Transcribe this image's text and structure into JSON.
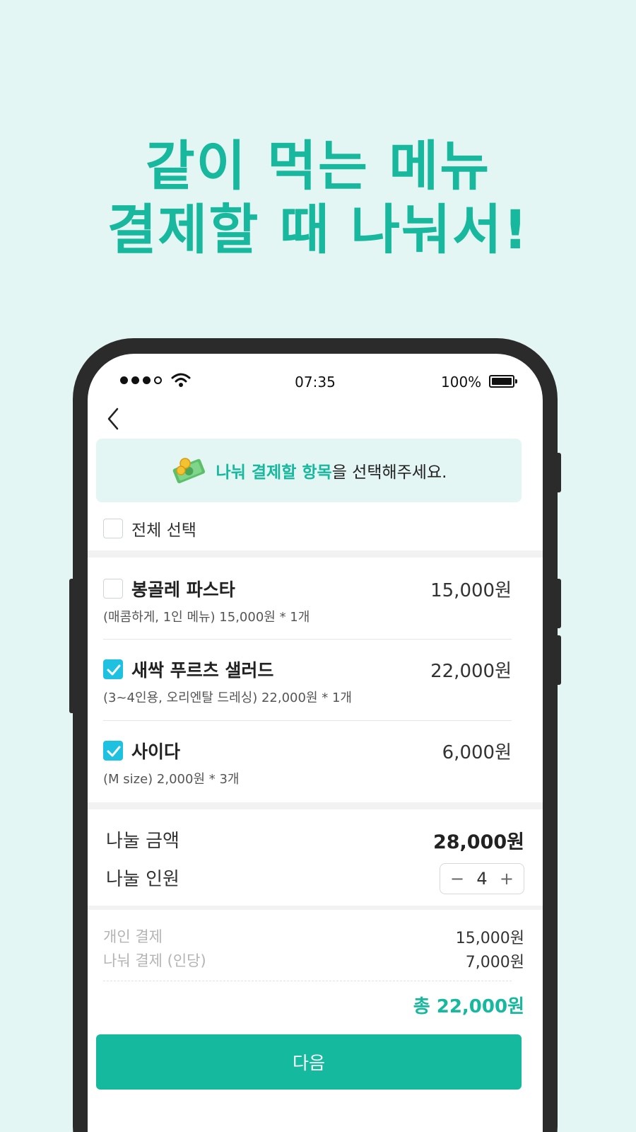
{
  "headline": {
    "line1": "같이 먹는 메뉴",
    "line2": "결제할 때 나눠서!"
  },
  "status_bar": {
    "time": "07:35",
    "battery": "100%",
    "battery_level": 1.0
  },
  "banner": {
    "highlight": "나눠 결제할 항목",
    "rest": "을 선택해주세요."
  },
  "select_all": {
    "label": "전체 선택",
    "checked": false
  },
  "items": [
    {
      "name": "봉골레 파스타",
      "price": "15,000원",
      "desc": "(매콤하게, 1인 메뉴) 15,000원 * 1개",
      "checked": false
    },
    {
      "name": "새싹 푸르츠 샐러드",
      "price": "22,000원",
      "desc": "(3~4인용, 오리엔탈 드레싱) 22,000원 * 1개",
      "checked": true
    },
    {
      "name": "사이다",
      "price": "6,000원",
      "desc": "(M size) 2,000원 * 3개",
      "checked": true
    }
  ],
  "split": {
    "amount_label": "나눌 금액",
    "amount_value": "28,000원",
    "people_label": "나눌 인원",
    "people_count": "4",
    "minus": "−",
    "plus": "+"
  },
  "summary": {
    "personal_label": "개인 결제",
    "personal_value": "15,000원",
    "split_label": "나눠 결제 (인당)",
    "split_value": "7,000원",
    "total": "총 22,000원"
  },
  "next_button": "다음",
  "colors": {
    "accent": "#17b89d",
    "checkbox": "#1ec1e0",
    "background": "#e3f6f3"
  }
}
